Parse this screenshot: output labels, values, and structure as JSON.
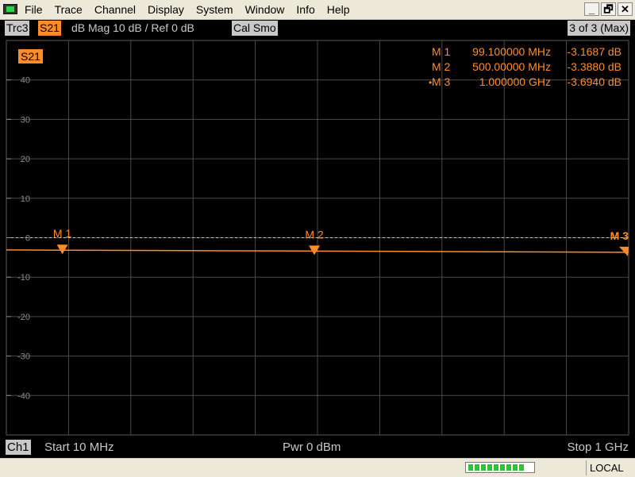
{
  "menu": [
    "File",
    "Trace",
    "Channel",
    "Display",
    "System",
    "Window",
    "Info",
    "Help"
  ],
  "window_controls": {
    "minimize": "_",
    "restore": "🗗",
    "close": "✕"
  },
  "tracebar": {
    "trace": "Trc3",
    "param": "S21",
    "format": "dB Mag  10 dB /  Ref 0 dB",
    "cal": "Cal Smo",
    "count": "3 of 3 (Max)"
  },
  "plot": {
    "param_label": "S21",
    "grid_color": "#4a4a4a",
    "trace_color": "#ff8c2a",
    "ref_line_color": "#c8c8c8",
    "y_ticks": [
      {
        "value": 40,
        "label": "40"
      },
      {
        "value": 30,
        "label": "30"
      },
      {
        "value": 20,
        "label": "20"
      },
      {
        "value": 10,
        "label": "10"
      },
      {
        "value": 0,
        "label": "0"
      },
      {
        "value": -10,
        "label": "-10"
      },
      {
        "value": -20,
        "label": "-20"
      },
      {
        "value": -30,
        "label": "-30"
      },
      {
        "value": -40,
        "label": "-40"
      }
    ]
  },
  "markers_table": [
    {
      "name": "M 1",
      "freq": "99.100000 MHz",
      "val": "-3.1687 dB",
      "active": false
    },
    {
      "name": "M 2",
      "freq": "500.00000 MHz",
      "val": "-3.3880 dB",
      "active": false
    },
    {
      "name": "M 3",
      "freq": "1.000000 GHz",
      "val": "-3.6940 dB",
      "active": true
    }
  ],
  "chart_data": {
    "type": "line",
    "x_unit": "MHz",
    "y_unit": "dB",
    "xlim": [
      10,
      1000
    ],
    "ylim": [
      -50,
      50
    ],
    "series": [
      {
        "x": [
          10,
          99.1,
          300,
          500,
          750,
          1000
        ],
        "y": [
          -3.1,
          -3.1687,
          -3.28,
          -3.388,
          -3.55,
          -3.694
        ]
      }
    ],
    "markers": [
      {
        "label": "M 1",
        "x": 99.1,
        "y": -3.1687
      },
      {
        "label": "M 2",
        "x": 500,
        "y": -3.388
      },
      {
        "label": "M 3",
        "x": 1000,
        "y": -3.694
      }
    ]
  },
  "status": {
    "channel": "Ch1",
    "start": "Start  10 MHz",
    "power": "Pwr  0 dBm",
    "stop": "Stop  1 GHz"
  },
  "bottom": {
    "progress_segments": 9,
    "mode": "LOCAL"
  }
}
